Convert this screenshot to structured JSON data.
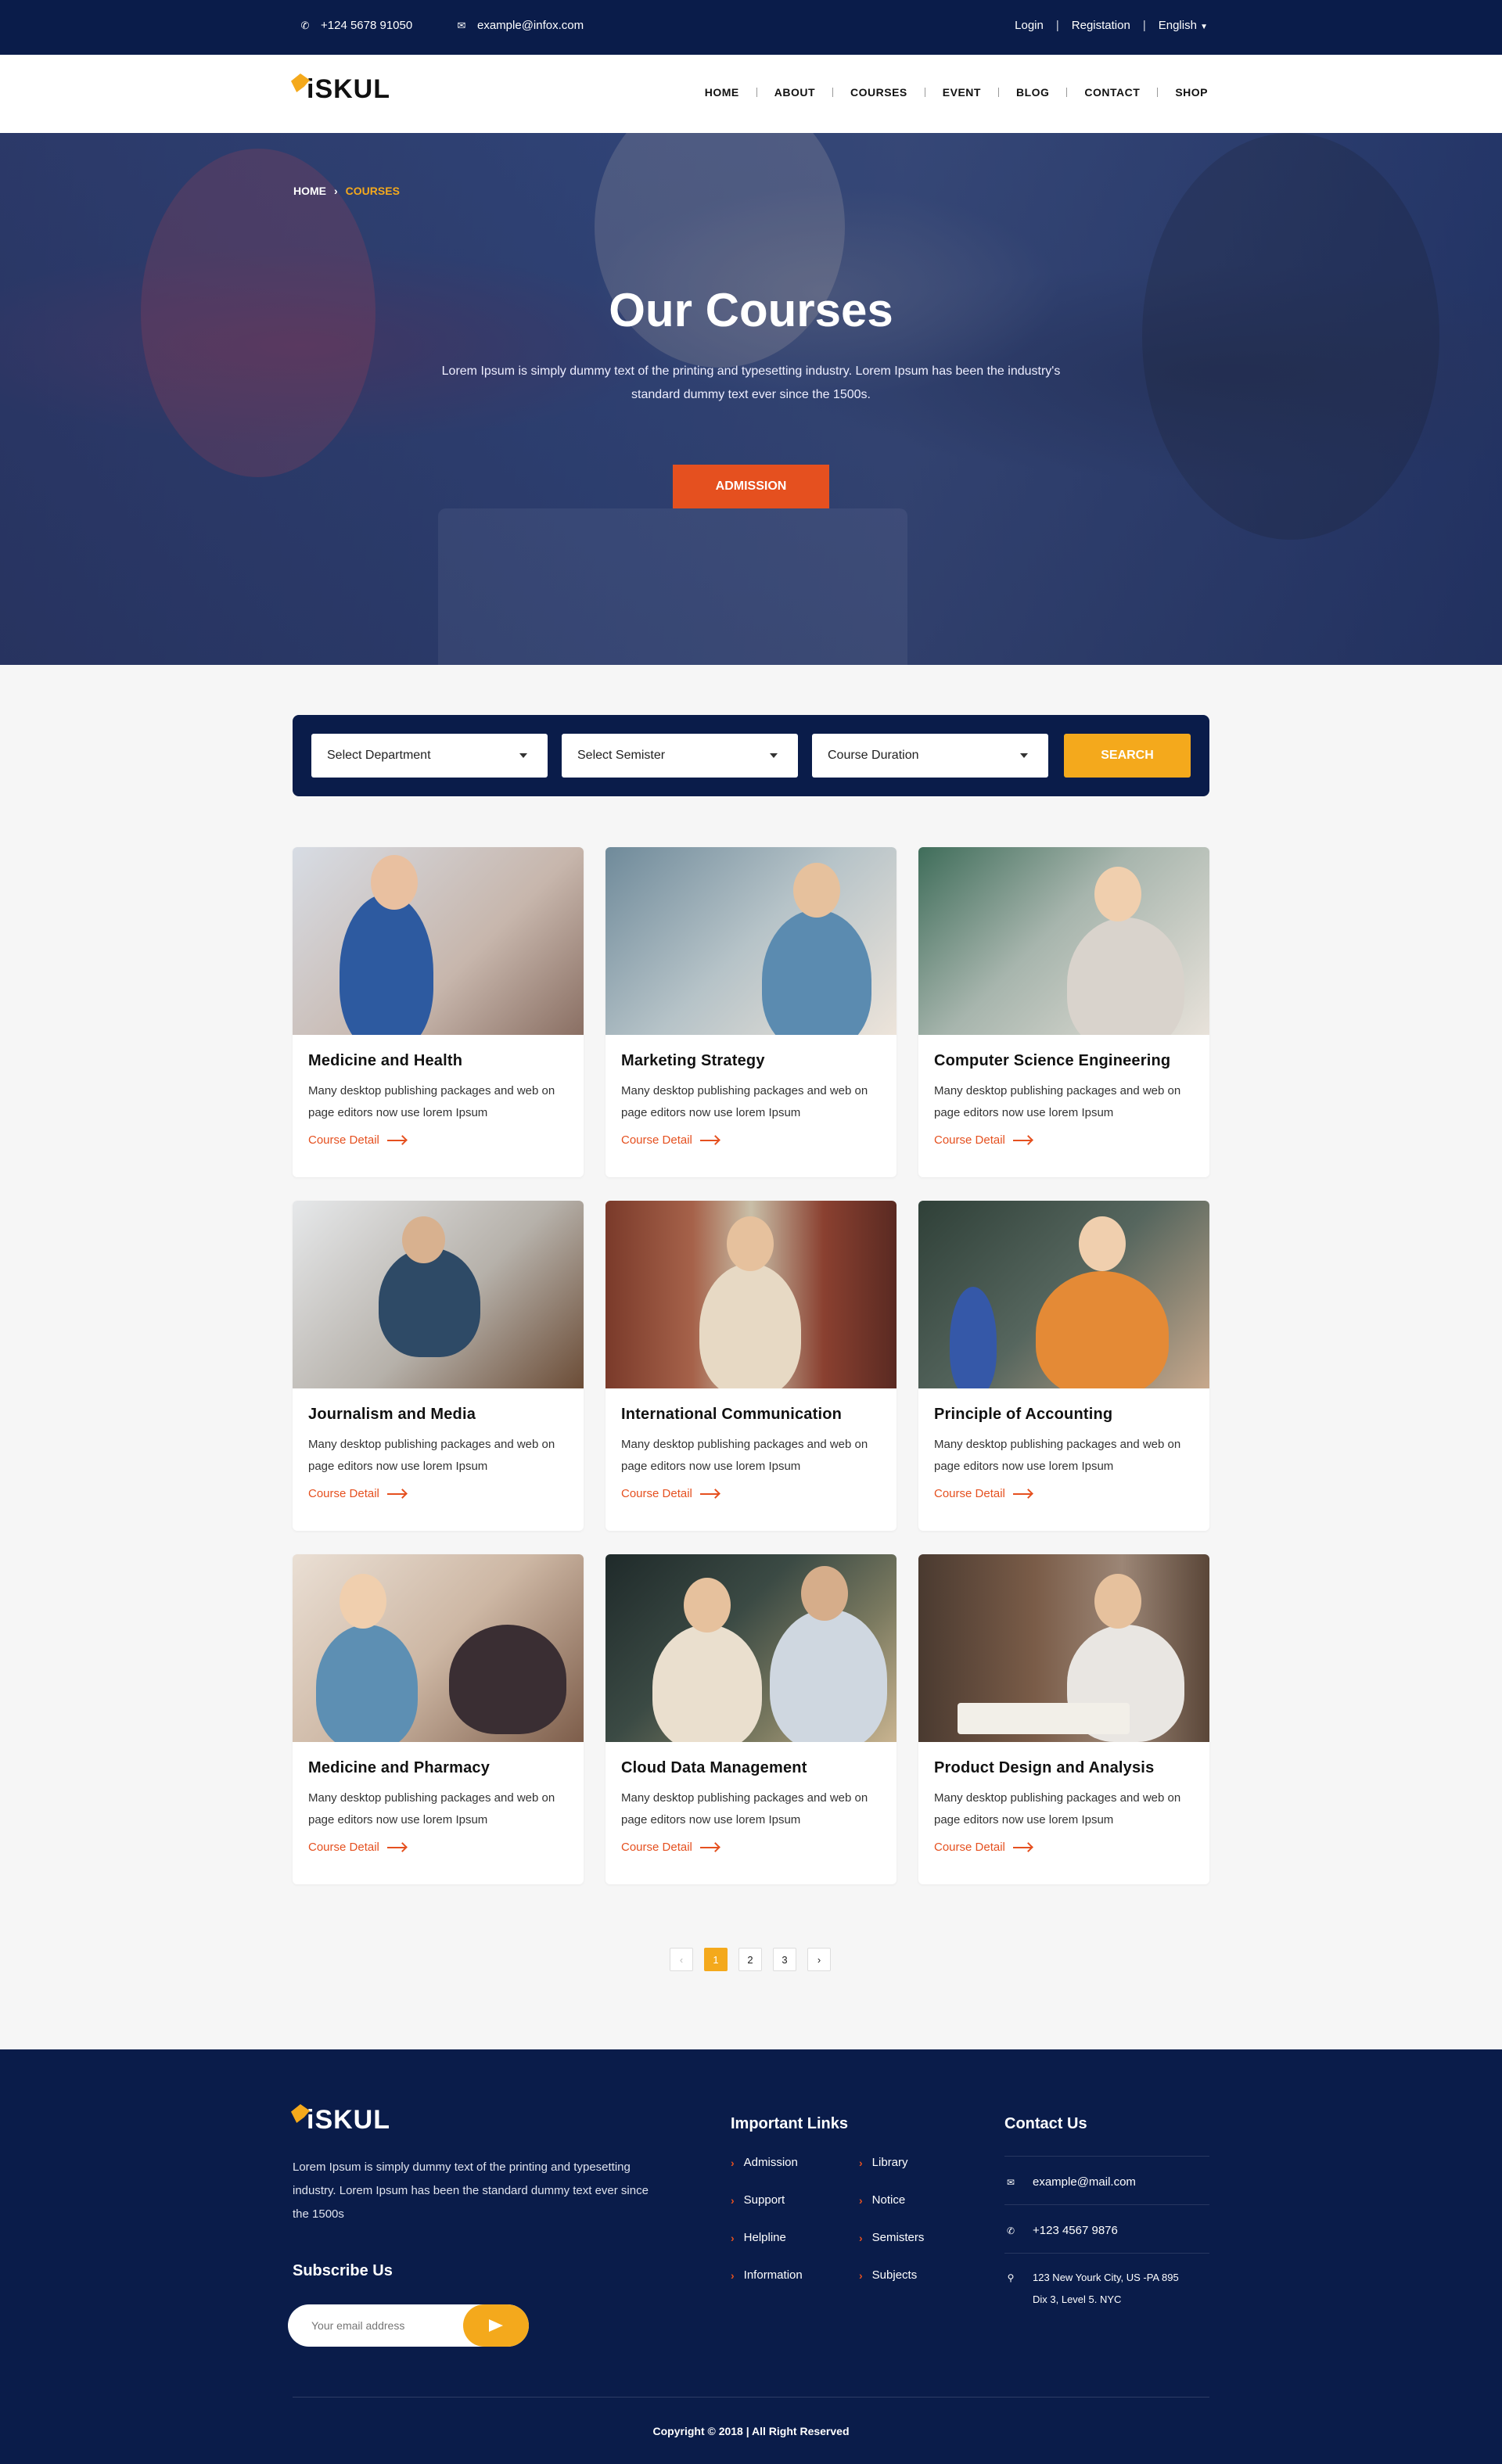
{
  "topbar": {
    "phone": "+124 5678 91050",
    "email": "example@infox.com",
    "login": "Login",
    "registration": "Registation",
    "language": "English"
  },
  "brand": {
    "name": "iSKUL"
  },
  "nav": {
    "items": [
      "HOME",
      "ABOUT",
      "COURSES",
      "EVENT",
      "BLOG",
      "CONTACT",
      "SHOP"
    ]
  },
  "hero": {
    "breadcrumb_home": "HOME",
    "breadcrumb_current": "COURSES",
    "title": "Our Courses",
    "description": "Lorem Ipsum is simply dummy text of the printing and typesetting industry. Lorem Ipsum has been the industry's standard dummy text ever since the 1500s.",
    "button": "ADMISSION"
  },
  "search": {
    "department": "Select Department",
    "semester": "Select Semister",
    "duration": "Course Duration",
    "button": "SEARCH"
  },
  "courses": [
    {
      "title": "Medicine and Health",
      "desc": "Many desktop publishing packages and web on page editors now use lorem Ipsum",
      "link": "Course Detail"
    },
    {
      "title": "Marketing Strategy",
      "desc": "Many desktop publishing packages and web on page editors now use lorem Ipsum",
      "link": "Course Detail"
    },
    {
      "title": "Computer Science Engineering",
      "desc": "Many desktop publishing packages and web on page editors now use lorem Ipsum",
      "link": "Course Detail"
    },
    {
      "title": "Journalism and Media",
      "desc": "Many desktop publishing packages and web on page editors now use lorem Ipsum",
      "link": "Course Detail"
    },
    {
      "title": "International Communication",
      "desc": "Many desktop publishing packages and web on page editors now use lorem Ipsum",
      "link": "Course Detail"
    },
    {
      "title": "Principle of Accounting",
      "desc": "Many desktop publishing packages and web on page editors now use lorem Ipsum",
      "link": "Course Detail"
    },
    {
      "title": "Medicine and Pharmacy",
      "desc": "Many desktop publishing packages and web on page editors now use lorem Ipsum",
      "link": "Course Detail"
    },
    {
      "title": "Cloud Data Management",
      "desc": "Many desktop publishing packages and web on page editors now use lorem Ipsum",
      "link": "Course Detail"
    },
    {
      "title": "Product Design and Analysis",
      "desc": "Many desktop publishing packages and web on page editors now use lorem Ipsum",
      "link": "Course Detail"
    }
  ],
  "pagination": {
    "prev": "‹",
    "pages": [
      "1",
      "2",
      "3"
    ],
    "current": "1",
    "next": "›"
  },
  "footer": {
    "about": "Lorem Ipsum is simply dummy text of the printing and typesetting industry. Lorem Ipsum has been the standard dummy text ever since the 1500s",
    "subscribe_title": "Subscribe Us",
    "subscribe_placeholder": "Your email address",
    "links_title": "Important Links",
    "links_col1": [
      "Admission",
      "Support",
      "Helpline",
      "Information"
    ],
    "links_col2": [
      "Library",
      "Notice",
      "Semisters",
      "Subjects"
    ],
    "contact_title": "Contact Us",
    "contact_email": "example@mail.com",
    "contact_phone": "+123 4567 9876",
    "contact_address_1": "123 New Yourk City, US -PA 895",
    "contact_address_2": "Dix 3, Level 5. NYC",
    "copyright": "Copyright © 2018 |  All Right Reserved"
  },
  "icons": {
    "phone": "phone-icon",
    "mail": "mail-icon",
    "location": "location-pin-icon",
    "send": "send-icon"
  },
  "colors": {
    "navy": "#0a1c4a",
    "orange": "#e5501f",
    "amber": "#f4a91c"
  }
}
